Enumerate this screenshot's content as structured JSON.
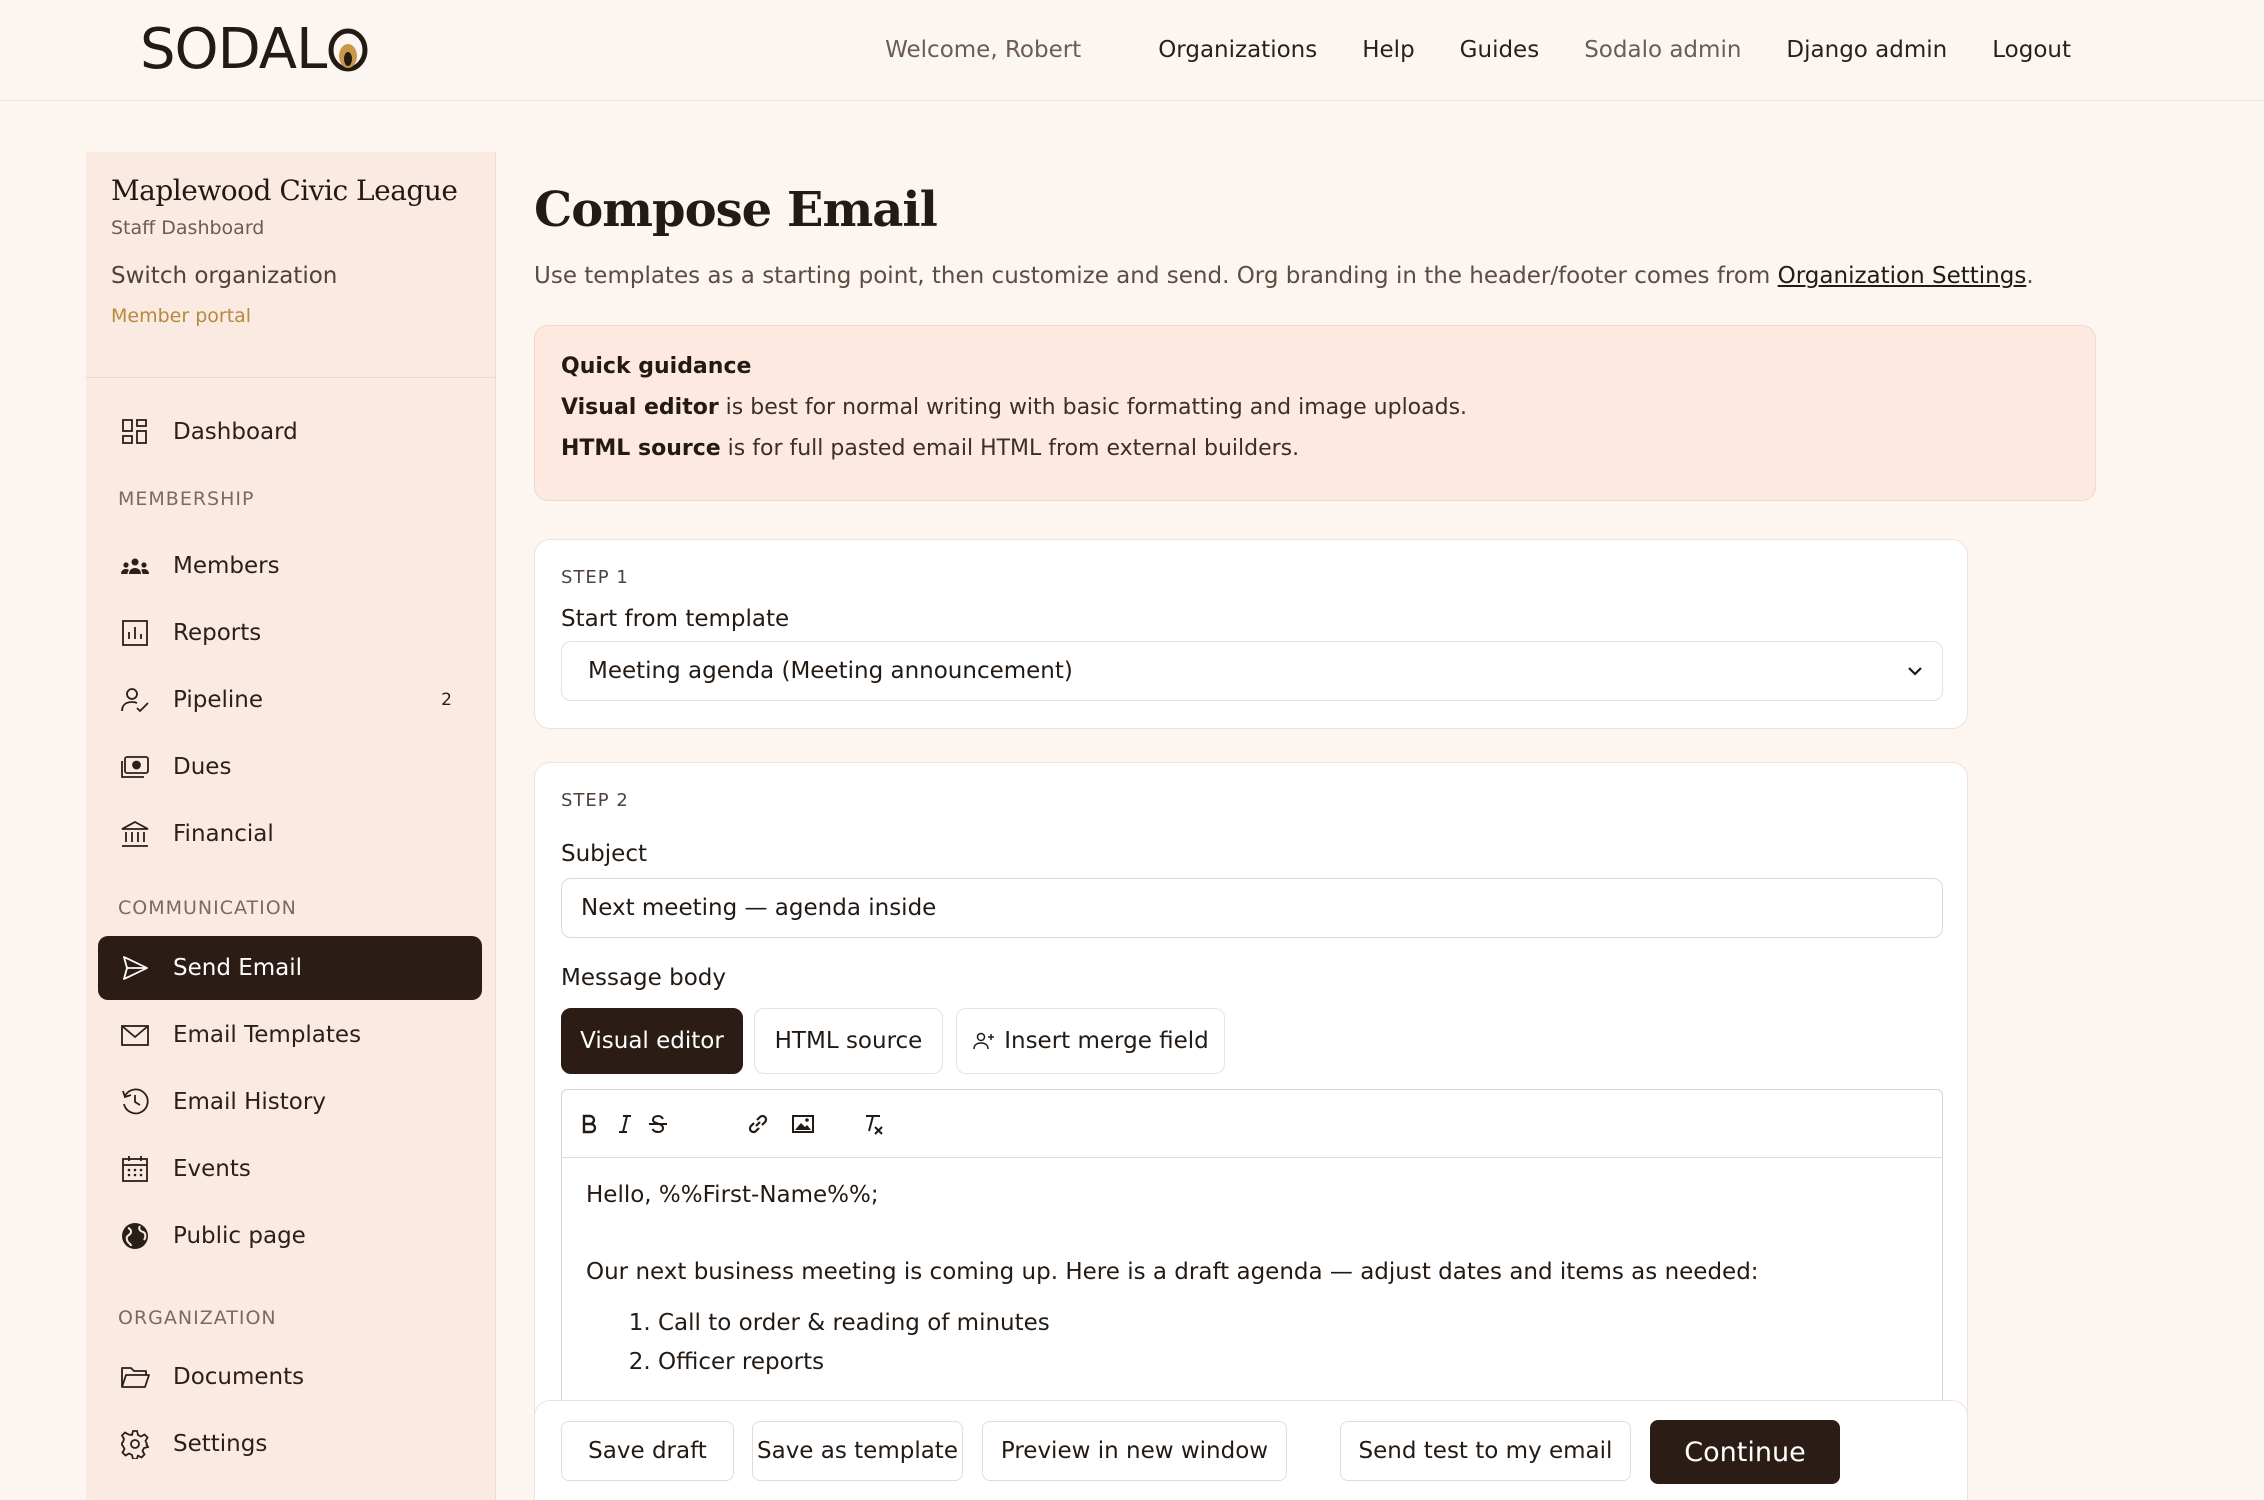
{
  "header": {
    "logo_text": "SODAL",
    "welcome": "Welcome, Robert",
    "nav": {
      "organizations": "Organizations",
      "help": "Help",
      "guides": "Guides",
      "sodalo_admin": "Sodalo admin",
      "django_admin": "Django admin",
      "logout": "Logout"
    }
  },
  "sidebar": {
    "org_name": "Maplewood Civic League",
    "org_subtitle": "Staff Dashboard",
    "switch_org": "Switch organization",
    "member_portal": "Member portal",
    "dashboard": "Dashboard",
    "sections": {
      "membership": "MEMBERSHIP",
      "communication": "COMMUNICATION",
      "organization": "ORGANIZATION"
    },
    "items": {
      "members": "Members",
      "reports": "Reports",
      "pipeline": "Pipeline",
      "pipeline_badge": "2",
      "dues": "Dues",
      "financial": "Financial",
      "send_email": "Send Email",
      "email_templates": "Email Templates",
      "email_history": "Email History",
      "events": "Events",
      "public_page": "Public page",
      "documents": "Documents",
      "settings": "Settings"
    }
  },
  "main": {
    "title": "Compose Email",
    "description": "Use templates as a starting point, then customize and send. Org branding in the header/footer comes from ",
    "description_link": "Organization Settings",
    "description_end": ".",
    "guidance": {
      "title": "Quick guidance",
      "line1_bold": "Visual editor",
      "line1_rest": " is best for normal writing with basic formatting and image uploads.",
      "line2_bold": "HTML source",
      "line2_rest": " is for full pasted email HTML from external builders."
    },
    "step1": {
      "label": "STEP 1",
      "field_label": "Start from template",
      "selected_template": "Meeting agenda (Meeting announcement)"
    },
    "step2": {
      "label": "STEP 2",
      "subject_label": "Subject",
      "subject_value": "Next meeting — agenda inside",
      "body_label": "Message body",
      "tabs": {
        "visual": "Visual editor",
        "html": "HTML source",
        "merge": "Insert merge field"
      },
      "body": {
        "greeting": "Hello, %%First-Name%%;",
        "paragraph": "Our next business meeting is coming up. Here is a draft agenda — adjust dates and items as needed:",
        "items": [
          "Call to order & reading of minutes",
          "Officer reports"
        ]
      }
    },
    "actions": {
      "save_draft": "Save draft",
      "save_template": "Save as template",
      "preview": "Preview in new window",
      "send_test": "Send test to my email",
      "continue": "Continue"
    }
  },
  "colors": {
    "accent_dark": "#2b1d15",
    "background": "#fcf5f0",
    "sidebar_bg": "#fbeae2",
    "guidance_bg": "#fde9e0",
    "portal_link": "#b48a3e"
  }
}
